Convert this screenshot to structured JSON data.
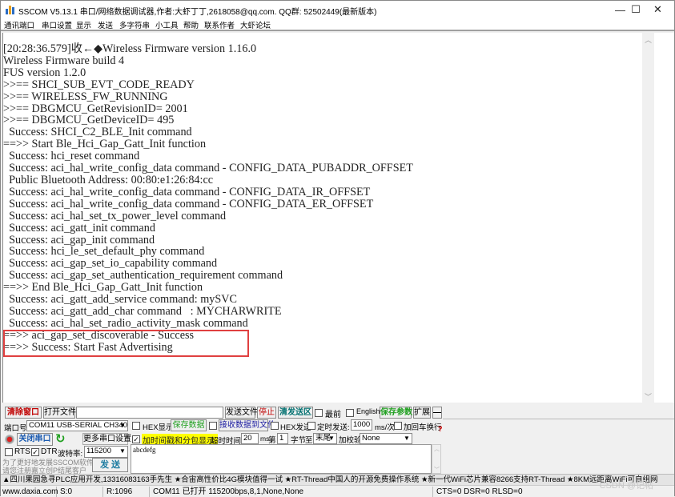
{
  "window": {
    "title": "SSCOM V5.13.1 串口/网络数据调试器,作者:大虾丁丁,2618058@qq.com. QQ群: 52502449(最新版本)",
    "controls": {
      "minimize": "—",
      "maximize": "☐",
      "close": "✕"
    }
  },
  "menu": [
    "通讯端口",
    "串口设置",
    "显示",
    "发送",
    "多字符串",
    "小工具",
    "帮助",
    "联系作者",
    "大虾论坛"
  ],
  "receive": {
    "lines": [
      "[20:28:36.579]收←◆Wireless Firmware version 1.16.0",
      "Wireless Firmware build 4",
      "FUS version 1.2.0",
      ">>== SHCI_SUB_EVT_CODE_READY",
      ">>== WIRELESS_FW_RUNNING",
      ">>== DBGMCU_GetRevisionID= 2001",
      ">>== DBGMCU_GetDeviceID= 495",
      "  Success: SHCI_C2_BLE_Init command",
      "==>> Start Ble_Hci_Gap_Gatt_Init function",
      "  Success: hci_reset command",
      "  Success: aci_hal_write_config_data command - CONFIG_DATA_PUBADDR_OFFSET",
      "  Public Bluetooth Address: 00:80:e1:26:84:cc",
      "  Success: aci_hal_write_config_data command - CONFIG_DATA_IR_OFFSET",
      "  Success: aci_hal_write_config_data command - CONFIG_DATA_ER_OFFSET",
      "  Success: aci_hal_set_tx_power_level command",
      "  Success: aci_gatt_init command",
      "  Success: aci_gap_init command",
      "  Success: hci_le_set_default_phy command",
      "  Success: aci_gap_set_io_capability command",
      "  Success: aci_gap_set_authentication_requirement command",
      "==>> End Ble_Hci_Gap_Gatt_Init function",
      "  Success: aci_gatt_add_service command: mySVC",
      "  Success: aci_gatt_add_char command   : MYCHARWRITE",
      "  Success: aci_hal_set_radio_activity_mask command",
      "==>> aci_gap_set_discoverable - Success",
      "==>> Success: Start Fast Advertising"
    ],
    "highlight_color": "#e04040"
  },
  "toolbar": {
    "clear_window": "清除窗口",
    "open_file": "打开文件",
    "file_path": "",
    "send_file": "发送文件",
    "stop": "停止",
    "clear_send": "清发送区",
    "topmost": {
      "label": "最前",
      "checked": false
    },
    "english": {
      "label": "English",
      "checked": false
    },
    "save_params": "保存参数",
    "expand": "扩展",
    "collapse": "—"
  },
  "port": {
    "port_label": "端口号",
    "port_value": "COM11 USB-SERIAL CH340",
    "close_port": "关闭串口",
    "more_settings": "更多串口设置",
    "rts": {
      "label": "RTS",
      "checked": false
    },
    "dtr": {
      "label": "DTR",
      "checked": true
    },
    "baud_label": "波特率:",
    "baud_value": "115200",
    "promo": "为了更好地发展SSCOM软件\n请您注册嘉立创P结尾客户",
    "send": "发 送"
  },
  "options": {
    "hex_display": {
      "label": "HEX显示",
      "checked": false
    },
    "save_data": "保存数据",
    "recv_to_file": {
      "label": "接收数据到文件",
      "checked": false
    },
    "hex_send": {
      "label": "HEX发送",
      "checked": false
    },
    "timed_send": {
      "label": "定时发送:",
      "checked": false
    },
    "interval_value": "1000",
    "interval_unit": "ms/次",
    "add_crlf": {
      "label": "加回车换行",
      "checked": false
    },
    "timestamp": {
      "label": "加时间戳和分包显示.",
      "checked": true
    },
    "timeout_label": "超时时间:",
    "timeout_value": "20",
    "timeout_unit": "ms",
    "byte_from_label": "第",
    "byte_from_value": "1",
    "byte_unit": "字节",
    "to_label": "至",
    "to_value": "末尾",
    "checksum_label": "加校验",
    "checksum_value": "None",
    "help": "?"
  },
  "send_text": "abcdefg",
  "ad_bar": "▲四川果园急寻PLC应用开发,13316083163手先生 ★合宙高性价比4G模块值得一试 ★RT-Thread中国人的开源免费操作系统 ★新一代WiFi芯片兼容8266支持RT-Thread ★8KM远距离WiFi可自组网",
  "status": {
    "website": "www.daxia.com",
    "sent": "S:0",
    "received": "R:1096",
    "port_state": "COM11 已打开  115200bps,8,1,None,None",
    "lines": "CTS=0 DSR=0 RLSD=0"
  },
  "watermark": "CSDN @记帖"
}
